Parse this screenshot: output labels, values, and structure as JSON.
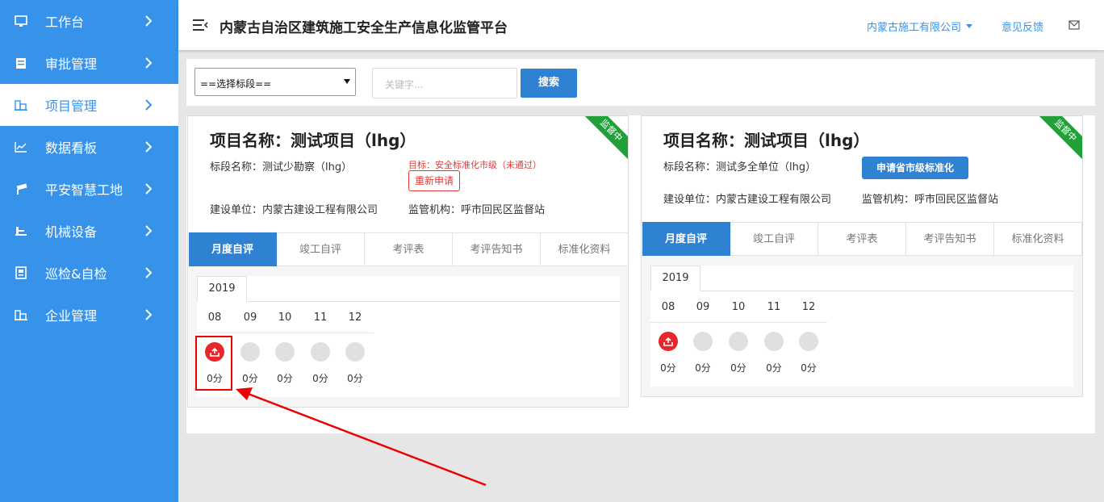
{
  "sidebar": {
    "items": [
      {
        "label": "工作台",
        "icon": "monitor-icon",
        "active": false
      },
      {
        "label": "审批管理",
        "icon": "approval-icon",
        "active": false
      },
      {
        "label": "项目管理",
        "icon": "building-icon",
        "active": true
      },
      {
        "label": "数据看板",
        "icon": "chart-icon",
        "active": false
      },
      {
        "label": "平安智慧工地",
        "icon": "camera-icon",
        "active": false
      },
      {
        "label": "机械设备",
        "icon": "machine-icon",
        "active": false
      },
      {
        "label": "巡检&自检",
        "icon": "clipboard-icon",
        "active": false
      },
      {
        "label": "企业管理",
        "icon": "enterprise-icon",
        "active": false
      }
    ]
  },
  "header": {
    "title": "内蒙古自治区建筑施工安全生产信息化监管平台",
    "company": "内蒙古施工有限公司",
    "feedback": "意见反馈"
  },
  "filter": {
    "select_value": "==选择标段==",
    "keyword_placeholder": "关键字...",
    "search_label": "搜索"
  },
  "cards": [
    {
      "ribbon": "监督中",
      "project_name": "项目名称：测试项目（lhg）",
      "section": "标段名称：测试少勘察（lhg）",
      "target": "目标：安全标准化市级（未通过）",
      "reapply": "重新申请",
      "builder": "建设单位：内蒙古建设工程有限公司",
      "supervisor": "监管机构：呼市回民区监督站",
      "tabs": [
        "月度自评",
        "竣工自评",
        "考评表",
        "考评告知书",
        "标准化资料"
      ],
      "year": "2019",
      "months": [
        "08",
        "09",
        "10",
        "11",
        "12"
      ],
      "scores": [
        "0分",
        "0分",
        "0分",
        "0分",
        "0分"
      ]
    },
    {
      "ribbon": "监督中",
      "project_name": "项目名称：测试项目（lhg）",
      "section": "标段名称：测试多全单位（lhg）",
      "apply_city": "申请省市级标准化",
      "builder": "建设单位：内蒙古建设工程有限公司",
      "supervisor": "监管机构：呼市回民区监督站",
      "tabs": [
        "月度自评",
        "竣工自评",
        "考评表",
        "考评告知书",
        "标准化资料"
      ],
      "year": "2019",
      "months": [
        "08",
        "09",
        "10",
        "11",
        "12"
      ],
      "scores": [
        "0分",
        "0分",
        "0分",
        "0分",
        "0分"
      ]
    }
  ],
  "colors": {
    "primary": "#3793ea",
    "button": "#2f82d1",
    "ribbon": "#21a03a",
    "alert": "#e53935"
  }
}
